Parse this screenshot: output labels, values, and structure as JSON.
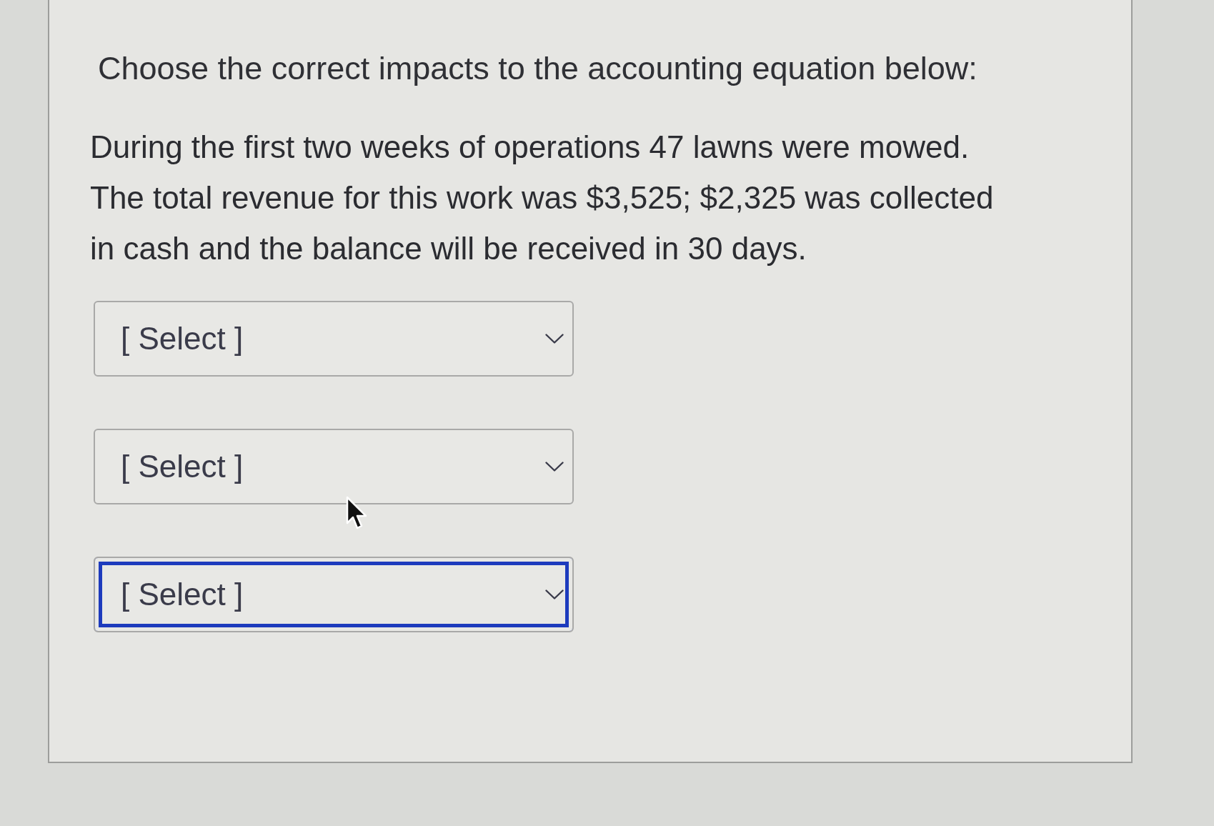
{
  "question": {
    "prompt": "Choose the correct impacts to the accounting equation below:",
    "scenario": "During the first two weeks of operations 47 lawns were mowed.\nThe total revenue for this work was $3,525; $2,325 was collected\nin cash and the balance will be received in 30 days."
  },
  "selects": [
    {
      "placeholder": "[ Select ]",
      "focused": false
    },
    {
      "placeholder": "[ Select ]",
      "focused": false
    },
    {
      "placeholder": "[ Select ]",
      "focused": true
    }
  ]
}
